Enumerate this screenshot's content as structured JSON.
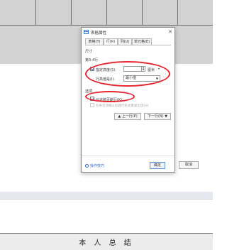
{
  "document": {
    "footer_text": "本 人 总 结"
  },
  "dialog": {
    "title": "表格属性",
    "close": "✕",
    "tabs": [
      "表格(T)",
      "行(R)",
      "列(U)",
      "单元格(E)"
    ],
    "active_tab": "行(R)",
    "size_section": "尺寸",
    "row_label": "第3-4行",
    "specify_height_label": "指定高度(S):",
    "specify_height_checked": true,
    "height_value": "",
    "height_unit": "厘米",
    "row_height_label": "行高值是(I):",
    "row_height_value": "最小值",
    "options_section": "选项",
    "allow_break_label": "允许跨页断行(K)",
    "allow_break_checked": true,
    "repeat_header_label": "在各页顶端以标题行形式重复出现(H)",
    "repeat_header_checked": false,
    "prev_row_button": "▲ 上一行(P)",
    "next_row_button": "下一行(N) ▼",
    "tips_link": "操作技巧",
    "ok_button": "确定",
    "cancel_button": "取消"
  },
  "colors": {
    "annotation": "#e8242c",
    "accent": "#2d6ac9"
  }
}
